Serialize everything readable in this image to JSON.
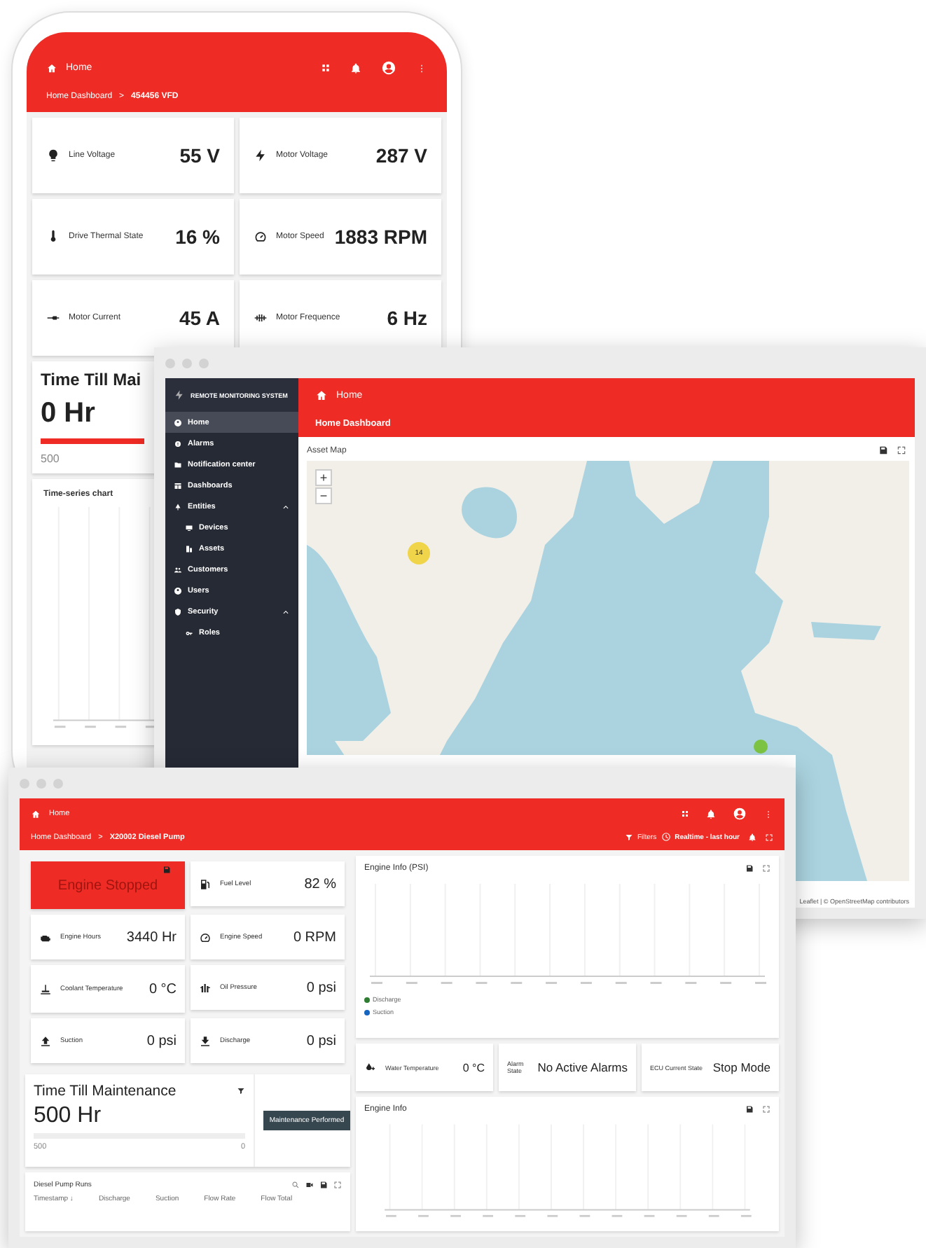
{
  "phone": {
    "header": {
      "title": "Home",
      "crumbs": [
        "Home Dashboard",
        ">",
        "454456 VFD"
      ]
    },
    "metrics": [
      {
        "label": "Line Voltage",
        "value": "55 V"
      },
      {
        "label": "Motor Voltage",
        "value": "287 V"
      },
      {
        "label": "Drive Thermal State",
        "value": "16 %"
      },
      {
        "label": "Motor Speed",
        "value": "1883 RPM"
      },
      {
        "label": "Motor Current",
        "value": "45 A"
      },
      {
        "label": "Motor Frequence",
        "value": "6 Hz"
      }
    ],
    "maintenance": {
      "title": "Time Till Mai",
      "value": "0 Hr",
      "level": 1,
      "start": "500"
    },
    "chart": {
      "title": "Time-series chart"
    }
  },
  "map_window": {
    "sidebar": {
      "brand": "REMOTE MONITORING SYSTEM",
      "items": [
        {
          "label": "Home",
          "selected": true
        },
        {
          "label": "Alarms",
          "selected": false
        },
        {
          "label": "Notification center",
          "selected": false
        },
        {
          "label": "Dashboards",
          "selected": false
        },
        {
          "label": "Entities",
          "selected": false,
          "expanded": true,
          "children": [
            {
              "label": "Devices",
              "selected": false
            },
            {
              "label": "Assets",
              "selected": false
            }
          ]
        },
        {
          "label": "Customers",
          "selected": false
        },
        {
          "label": "Users",
          "selected": false
        },
        {
          "label": "Security",
          "selected": false,
          "expanded": true,
          "children": [
            {
              "label": "Roles",
              "selected": false
            }
          ]
        }
      ]
    },
    "header": {
      "title": "Home",
      "subtitle": "Home Dashboard"
    },
    "map": {
      "title": "Asset Map",
      "zoom_in": "+",
      "zoom_out": "−",
      "cluster": "14",
      "attribution": "Leaflet | © OpenStreetMap contributors"
    }
  },
  "pump_window": {
    "header": {
      "title": "Home",
      "crumbs": [
        "Home Dashboard",
        ">",
        "X20002 Diesel Pump"
      ],
      "actions": [
        "Filters",
        "Realtime - last hour"
      ]
    },
    "status": {
      "text": "Engine Stopped",
      "alarm": true
    },
    "metrics": [
      {
        "label": "Fuel Level",
        "value": "82 %"
      },
      {
        "label": "Engine Hours",
        "value": "3440 Hr"
      },
      {
        "label": "Engine Speed",
        "value": "0 RPM"
      },
      {
        "label": "Coolant Temperature",
        "value": "0 °C"
      },
      {
        "label": "Oil Pressure",
        "value": "0 psi"
      },
      {
        "label": "Suction",
        "value": "0 psi"
      },
      {
        "label": "Discharge",
        "value": "0 psi"
      }
    ],
    "maintenance": {
      "title": "Time Till Maintenance",
      "value": "500 Hr",
      "level": 0,
      "start": "500",
      "end": "0",
      "button": "Maintenance Performed"
    },
    "table": {
      "title": "Diesel Pump Runs",
      "columns": [
        "Timestamp ↓",
        "Discharge",
        "Suction",
        "Flow Rate",
        "Flow Total"
      ]
    },
    "chart1": {
      "title": "Engine Info (PSI)",
      "legend": [
        "Discharge",
        "Suction"
      ]
    },
    "states": [
      {
        "label": "Water Temperature",
        "value": "0 °C"
      },
      {
        "label": "Alarm State",
        "value": "No Active Alarms"
      },
      {
        "label": "ECU Current State",
        "value": "Stop Mode"
      }
    ],
    "chart2": {
      "title": "Engine Info"
    }
  }
}
